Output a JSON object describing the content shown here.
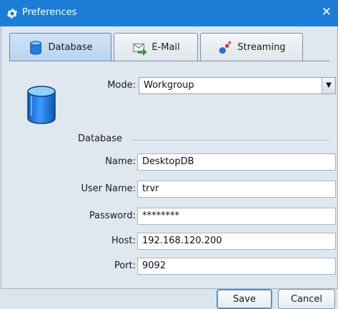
{
  "window": {
    "title": "Preferences",
    "close_glyph": "✕"
  },
  "tabs": [
    {
      "label": "Database",
      "icon": "database-icon",
      "active": true
    },
    {
      "label": "E-Mail",
      "icon": "email-arrow-icon",
      "active": false
    },
    {
      "label": "Streaming",
      "icon": "streaming-icon",
      "active": false
    }
  ],
  "form": {
    "mode_label": "Mode:",
    "mode_value": "Workgroup",
    "section_label": "Database",
    "name_label": "Name:",
    "name_value": "DesktopDB",
    "user_label": "User Name:",
    "user_value": "trvr",
    "password_label": "Password:",
    "password_value": "********",
    "host_label": "Host:",
    "host_value": "192.168.120.200",
    "port_label": "Port:",
    "port_value": "9092"
  },
  "buttons": {
    "save": "Save",
    "cancel": "Cancel"
  },
  "colors": {
    "titlebar": "#1c7dd6",
    "active_tab": "#c5dcf3",
    "db_icon": "#1f7fe0"
  }
}
